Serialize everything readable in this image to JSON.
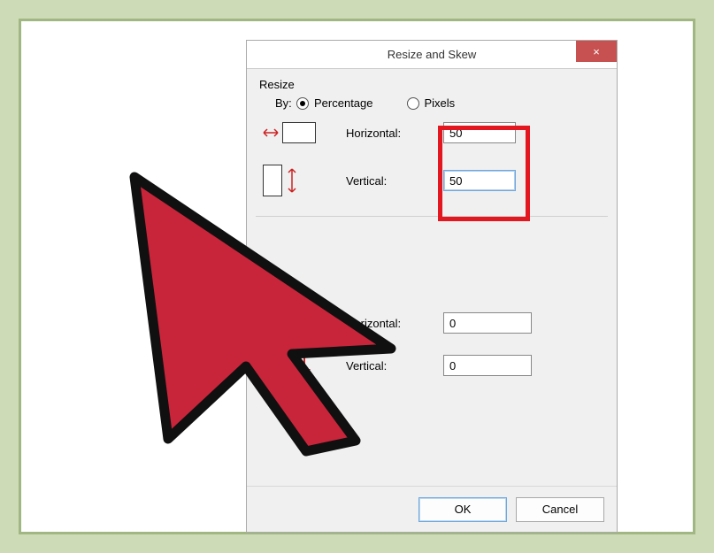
{
  "dialog": {
    "title": "Resize and Skew",
    "close_text": "×"
  },
  "resize": {
    "group_label": "Resize",
    "by_label": "By:",
    "radio_percentage": "Percentage",
    "radio_pixels": "Pixels",
    "radio_selected": "Percentage",
    "horizontal_label": "Horizontal:",
    "horizontal_value": "50",
    "vertical_label": "Vertical:",
    "vertical_value": "50"
  },
  "skew": {
    "horizontal_label": "Horizontal:",
    "horizontal_value": "0",
    "vertical_label": "Vertical:",
    "vertical_value": "0"
  },
  "footer": {
    "ok_label": "OK",
    "cancel_label": "Cancel"
  },
  "colors": {
    "highlight_red": "#e3171f",
    "cursor_fill": "#c9253a",
    "close_bg": "#c75050"
  }
}
